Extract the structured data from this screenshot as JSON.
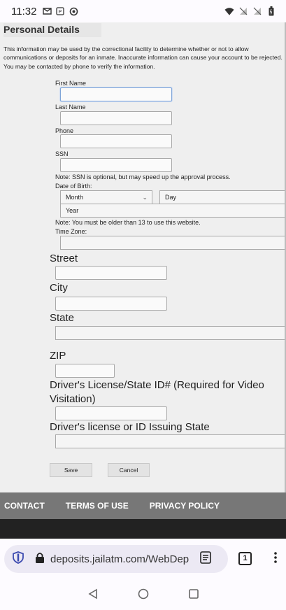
{
  "status_bar": {
    "time": "11:32"
  },
  "form": {
    "section_title": "Personal Details",
    "intro": "This information may be used by the correctional facility to determine whether or not to allow communications or deposits for an inmate. Inaccurate information can cause your account to be rejected. You may be contacted by phone to verify the information.",
    "first_name_label": "First Name",
    "last_name_label": "Last Name",
    "phone_label": "Phone",
    "ssn_label": "SSN",
    "ssn_note": "Note:  SSN is optional, but may speed up the approval process.",
    "dob_label": "Date of Birth:",
    "month_value": "Month",
    "day_value": "Day",
    "year_value": "Year",
    "age_note": "Note:  You must be older than 13 to use this website.",
    "timezone_label": "Time Zone:",
    "street_label": "Street",
    "city_label": "City",
    "state_label": "State",
    "zip_label": "ZIP",
    "license_label": "Driver's License/State ID# (Required for Video Visitation)",
    "issuing_state_label": "Driver's license or ID Issuing State",
    "save_label": "Save",
    "cancel_label": "Cancel"
  },
  "footer": {
    "links": [
      "CONTACT",
      "TERMS OF USE",
      "PRIVACY POLICY"
    ]
  },
  "browser": {
    "url": "deposits.jailatm.com/WebDep",
    "tab_count": "1"
  }
}
